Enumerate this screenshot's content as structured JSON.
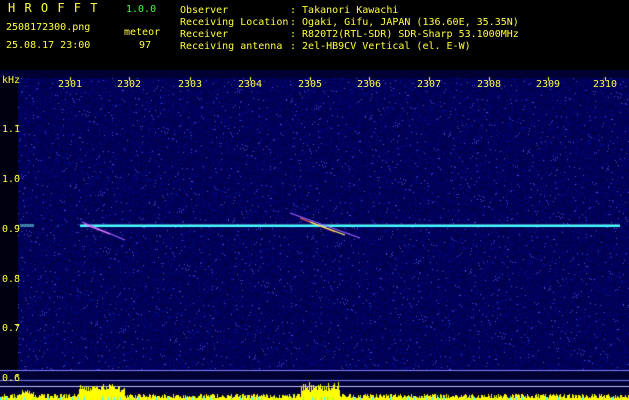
{
  "app": {
    "title": "H R O F F T",
    "version": "1.0.0",
    "filename": "2508172300.png",
    "datetime": "25.08.17 23:00",
    "event_label": "meteor",
    "event_count": "97"
  },
  "info": {
    "observer_label": "Observer",
    "observer_value": ": Takanori Kawachi",
    "location_label": "Receiving Location",
    "location_value": ": Ogaki, Gifu, JAPAN (136.60E, 35.35N)",
    "receiver_label": "Receiver",
    "receiver_value": ": R820T2(RTL-SDR) SDR-Sharp 53.1000MHz",
    "antenna_label": "Receiving antenna",
    "antenna_value": ": 2el-HB9CV Vertical (el. E-W)"
  },
  "axis": {
    "y_unit": "kHz",
    "x_ticks": [
      "2301",
      "2302",
      "2303",
      "2304",
      "2305",
      "2306",
      "2307",
      "2308",
      "2309",
      "2310"
    ],
    "y_ticks": [
      "1.1",
      "1.0",
      "0.9",
      "0.8",
      "0.7",
      "0.6"
    ]
  },
  "colors": {
    "background": "#000000",
    "noise": "#00005a",
    "carrier": "#40ffff",
    "label_yellow": "#ffff40",
    "label_green": "#40ff40",
    "level_bars": "#ffff00"
  }
}
